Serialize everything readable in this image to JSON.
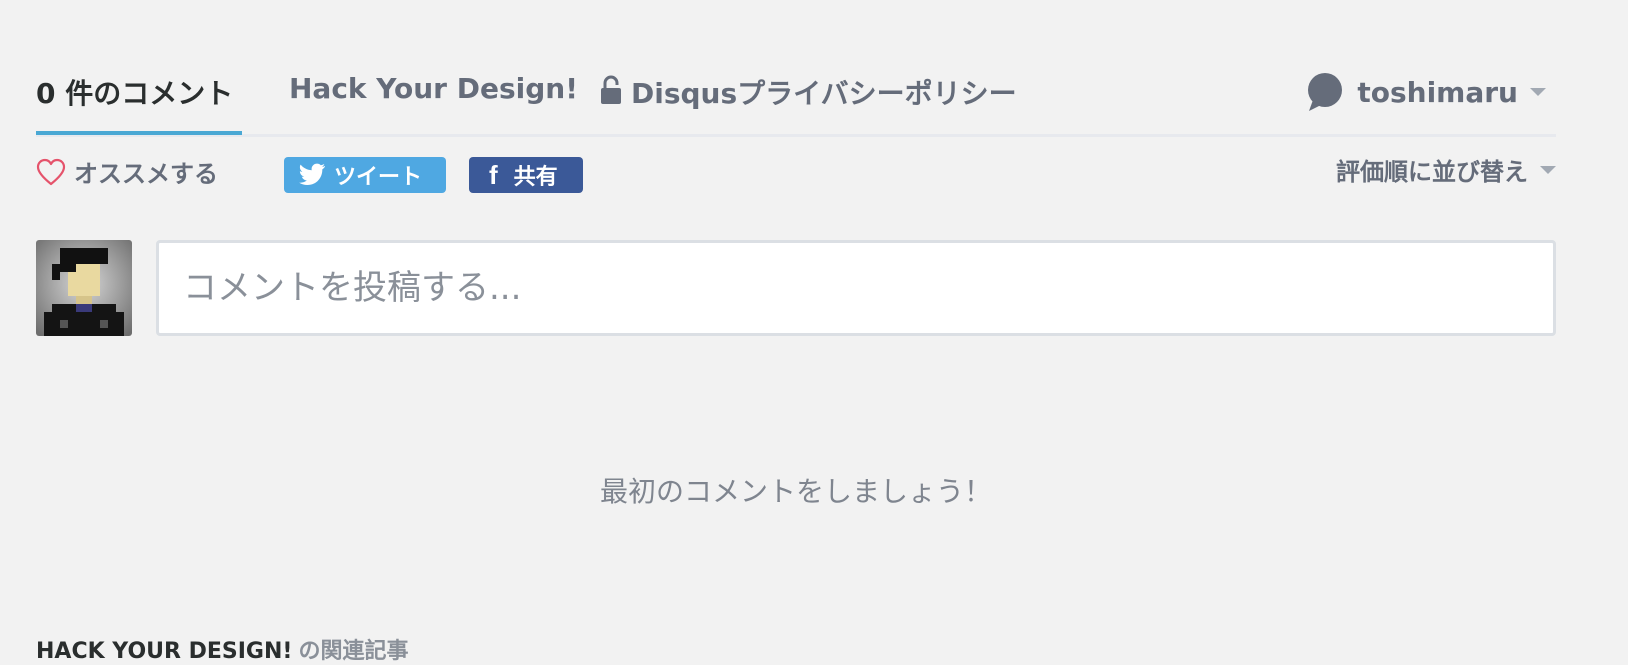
{
  "nav": {
    "comments_tab": "0 件のコメント",
    "site_tab": "Hack Your Design!",
    "privacy_tab": "Disqusプライバシーポリシー",
    "user_name": "toshimaru"
  },
  "actions": {
    "recommend_label": "オススメする",
    "tweet_label": "ツイート",
    "share_label": "共有",
    "sort_label": "評価順に並び替え"
  },
  "composer": {
    "placeholder": "コメントを投稿する..."
  },
  "empty_state": {
    "message": "最初のコメントをしましょう！"
  },
  "related": {
    "site_name": "HACK YOUR DESIGN!",
    "suffix": "の関連記事"
  },
  "icons": {
    "lock": "lock-icon",
    "user": "chat-bubble-icon",
    "dropdown": "caret-down-icon",
    "recommend": "heart-icon",
    "tweet": "twitter-icon",
    "share": "facebook-icon"
  },
  "colors": {
    "background": "#f2f2f2",
    "active_tab_underline": "#4aa8d4",
    "twitter": "#4fa8e2",
    "facebook": "#3b5998",
    "heart": "#e5536b",
    "muted_text": "#656c7a"
  }
}
